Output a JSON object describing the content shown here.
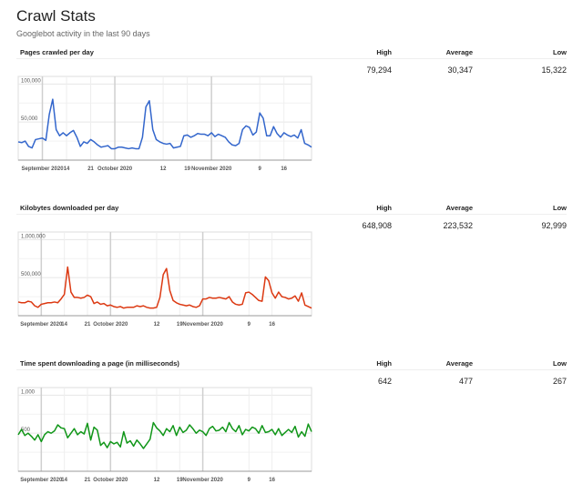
{
  "page": {
    "title": "Crawl Stats",
    "subtitle": "Googlebot activity in the last 90 days"
  },
  "columns": {
    "high": "High",
    "average": "Average",
    "low": "Low"
  },
  "sections": [
    {
      "title": "Pages crawled per day",
      "high": "79,294",
      "average": "30,347",
      "low": "15,322",
      "color": "#3366cc"
    },
    {
      "title": "Kilobytes downloaded per day",
      "high": "648,908",
      "average": "223,532",
      "low": "92,999",
      "color": "#dc3912"
    },
    {
      "title": "Time spent downloading a page (in milliseconds)",
      "high": "642",
      "average": "477",
      "low": "267",
      "color": "#109618"
    }
  ],
  "chart_data": [
    {
      "type": "line",
      "title": "Pages crawled per day",
      "x_tick_labels": [
        "September 2020",
        "14",
        "21",
        "October 2020",
        "12",
        "19",
        "November 2020",
        "9",
        "16"
      ],
      "x_tick_days": [
        7,
        14,
        21,
        28,
        42,
        49,
        56,
        70,
        77
      ],
      "y_tick_labels": [
        "100,000",
        "50,000"
      ],
      "ylim": [
        0,
        110000
      ],
      "grid": true,
      "series": [
        {
          "values": [
            24000,
            23000,
            25000,
            18000,
            16000,
            27000,
            28000,
            29000,
            26000,
            60000,
            80000,
            40000,
            32000,
            36000,
            32000,
            36000,
            39000,
            30000,
            18000,
            24000,
            22000,
            27000,
            24000,
            20000,
            17000,
            18000,
            19000,
            15000,
            15000,
            17000,
            17000,
            16000,
            15000,
            16000,
            15000,
            15000,
            30000,
            70000,
            78000,
            40000,
            27000,
            24000,
            22000,
            21000,
            22000,
            16000,
            17000,
            18000,
            32000,
            33000,
            30000,
            32000,
            35000,
            34000,
            34000,
            32000,
            36000,
            31000,
            34000,
            32000,
            30000,
            24000,
            20000,
            19000,
            22000,
            40000,
            45000,
            43000,
            33000,
            37000,
            62000,
            55000,
            32000,
            32000,
            44000,
            35000,
            30000,
            36000,
            33000,
            31000,
            33000,
            29000,
            40000,
            22000,
            20000,
            17000
          ]
        }
      ]
    },
    {
      "type": "line",
      "title": "Kilobytes downloaded per day",
      "x_tick_labels": [
        "September 2020",
        "14",
        "21",
        "October 2020",
        "12",
        "19",
        "November 2020",
        "9",
        "16"
      ],
      "x_tick_days": [
        7,
        14,
        21,
        28,
        42,
        49,
        56,
        70,
        77
      ],
      "y_tick_labels": [
        "1,000,000",
        "500,000"
      ],
      "ylim": [
        0,
        1100000
      ],
      "grid": true,
      "series": [
        {
          "values": [
            180000,
            170000,
            170000,
            190000,
            180000,
            130000,
            110000,
            150000,
            160000,
            170000,
            170000,
            180000,
            170000,
            220000,
            280000,
            640000,
            310000,
            240000,
            240000,
            230000,
            240000,
            270000,
            250000,
            160000,
            180000,
            150000,
            160000,
            130000,
            140000,
            120000,
            110000,
            120000,
            100000,
            110000,
            110000,
            110000,
            130000,
            120000,
            130000,
            110000,
            100000,
            100000,
            110000,
            240000,
            540000,
            620000,
            330000,
            200000,
            170000,
            150000,
            140000,
            130000,
            140000,
            120000,
            110000,
            130000,
            220000,
            220000,
            240000,
            230000,
            230000,
            240000,
            230000,
            220000,
            250000,
            180000,
            150000,
            140000,
            150000,
            300000,
            310000,
            280000,
            240000,
            200000,
            190000,
            510000,
            460000,
            300000,
            230000,
            310000,
            250000,
            240000,
            220000,
            230000,
            260000,
            190000,
            300000,
            140000,
            120000,
            100000
          ]
        }
      ]
    },
    {
      "type": "line",
      "title": "Time spent downloading a page (in milliseconds)",
      "x_tick_labels": [
        "September 2020",
        "14",
        "21",
        "October 2020",
        "12",
        "19",
        "November 2020",
        "9",
        "16"
      ],
      "x_tick_days": [
        7,
        14,
        21,
        28,
        42,
        49,
        56,
        70,
        77
      ],
      "y_tick_labels": [
        "1,000",
        "500"
      ],
      "ylim": [
        0,
        1100
      ],
      "grid": true,
      "series": [
        {
          "values": [
            480,
            550,
            470,
            500,
            460,
            410,
            480,
            390,
            480,
            520,
            500,
            530,
            610,
            570,
            560,
            440,
            500,
            560,
            480,
            520,
            490,
            630,
            410,
            580,
            540,
            340,
            380,
            310,
            390,
            360,
            380,
            320,
            520,
            370,
            400,
            330,
            410,
            360,
            300,
            360,
            420,
            640,
            570,
            530,
            470,
            560,
            520,
            600,
            470,
            580,
            510,
            540,
            610,
            560,
            500,
            540,
            520,
            470,
            560,
            590,
            530,
            540,
            580,
            520,
            640,
            560,
            520,
            600,
            480,
            550,
            530,
            580,
            560,
            500,
            600,
            510,
            520,
            550,
            480,
            560,
            470,
            510,
            550,
            510,
            590,
            450,
            520,
            460,
            620,
            520
          ]
        }
      ]
    }
  ]
}
